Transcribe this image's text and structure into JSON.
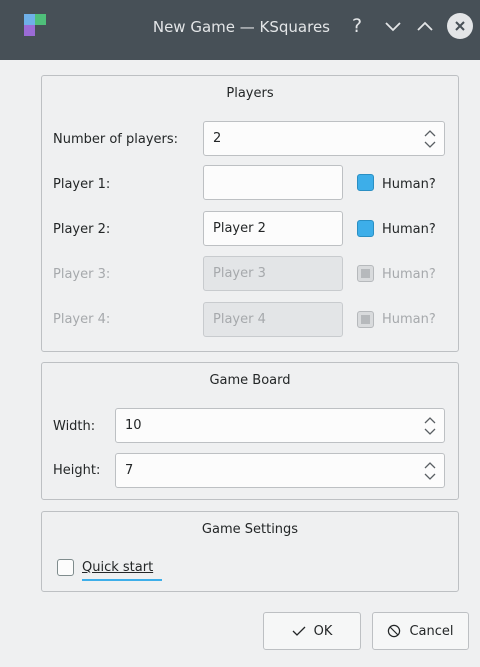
{
  "window": {
    "title": "New Game — KSquares",
    "help_glyph": "?"
  },
  "players_group": {
    "title": "Players",
    "num_players_label": "Number of players:",
    "num_players_value": "2",
    "players": [
      {
        "label": "Player 1:",
        "value": "",
        "human_label": "Human?",
        "human_checked": true,
        "enabled": true
      },
      {
        "label": "Player 2:",
        "value": "Player 2",
        "human_label": "Human?",
        "human_checked": true,
        "enabled": true
      },
      {
        "label": "Player 3:",
        "value": "Player 3",
        "human_label": "Human?",
        "human_checked": false,
        "enabled": false
      },
      {
        "label": "Player 4:",
        "value": "Player 4",
        "human_label": "Human?",
        "human_checked": false,
        "enabled": false
      }
    ]
  },
  "board_group": {
    "title": "Game Board",
    "width_label": "Width:",
    "width_value": "10",
    "height_label": "Height:",
    "height_value": "7"
  },
  "settings_group": {
    "title": "Game Settings",
    "quick_start_label": "Quick start",
    "quick_start_checked": false
  },
  "buttons": {
    "ok_label": "OK",
    "cancel_label": "Cancel"
  },
  "colors": {
    "titlebar": "#475057",
    "accent": "#3daee9",
    "window_bg": "#eff0f1"
  }
}
